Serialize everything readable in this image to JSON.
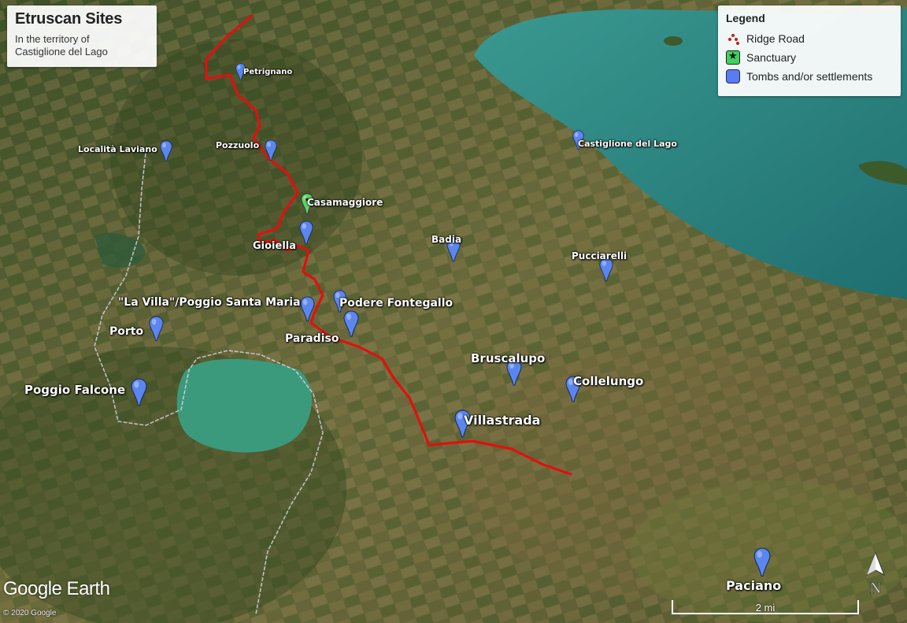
{
  "title": "Etruscan Sites",
  "subtitle_line1": "In the territory of",
  "subtitle_line2": "Castiglione del Lago",
  "legend": {
    "heading": "Legend",
    "items": [
      {
        "label": "Ridge Road",
        "icon": "red-dotted-path-icon"
      },
      {
        "label": "Sanctuary",
        "icon": "green-star-icon"
      },
      {
        "label": "Tombs and/or settlements",
        "icon": "blue-square-icon"
      }
    ]
  },
  "places": [
    {
      "name": "Petrignano",
      "type": "tomb"
    },
    {
      "name": "Località Laviano",
      "type": "tomb"
    },
    {
      "name": "Pozzuolo",
      "type": "tomb"
    },
    {
      "name": "Castiglione del Lago",
      "type": "tomb"
    },
    {
      "name": "Casamaggiore",
      "type": "sanctuary"
    },
    {
      "name": "Gioiella",
      "type": "tomb"
    },
    {
      "name": "Badia",
      "type": "tomb"
    },
    {
      "name": "Pucciarelli",
      "type": "tomb"
    },
    {
      "name": "\"La Villa\"/Poggio Santa Maria",
      "type": "tomb"
    },
    {
      "name": "Podere Fontegallo",
      "type": "tomb"
    },
    {
      "name": "Porto",
      "type": "tomb"
    },
    {
      "name": "Paradiso",
      "type": "tomb"
    },
    {
      "name": "Bruscalupo",
      "type": "tomb"
    },
    {
      "name": "Collelungo",
      "type": "tomb"
    },
    {
      "name": "Poggio Falcone",
      "type": "tomb"
    },
    {
      "name": "Villastrada",
      "type": "tomb"
    },
    {
      "name": "Paciano",
      "type": "tomb"
    }
  ],
  "logo_text": "Google Earth",
  "copyright": "© 2020 Google",
  "scale_label": "2 mi",
  "north_label": "N",
  "colors": {
    "ridge_road": "#e01010",
    "lake": "#2f8a86",
    "tomb_pin": "#5b86ee",
    "sanctuary_pin": "#5fd35c"
  }
}
